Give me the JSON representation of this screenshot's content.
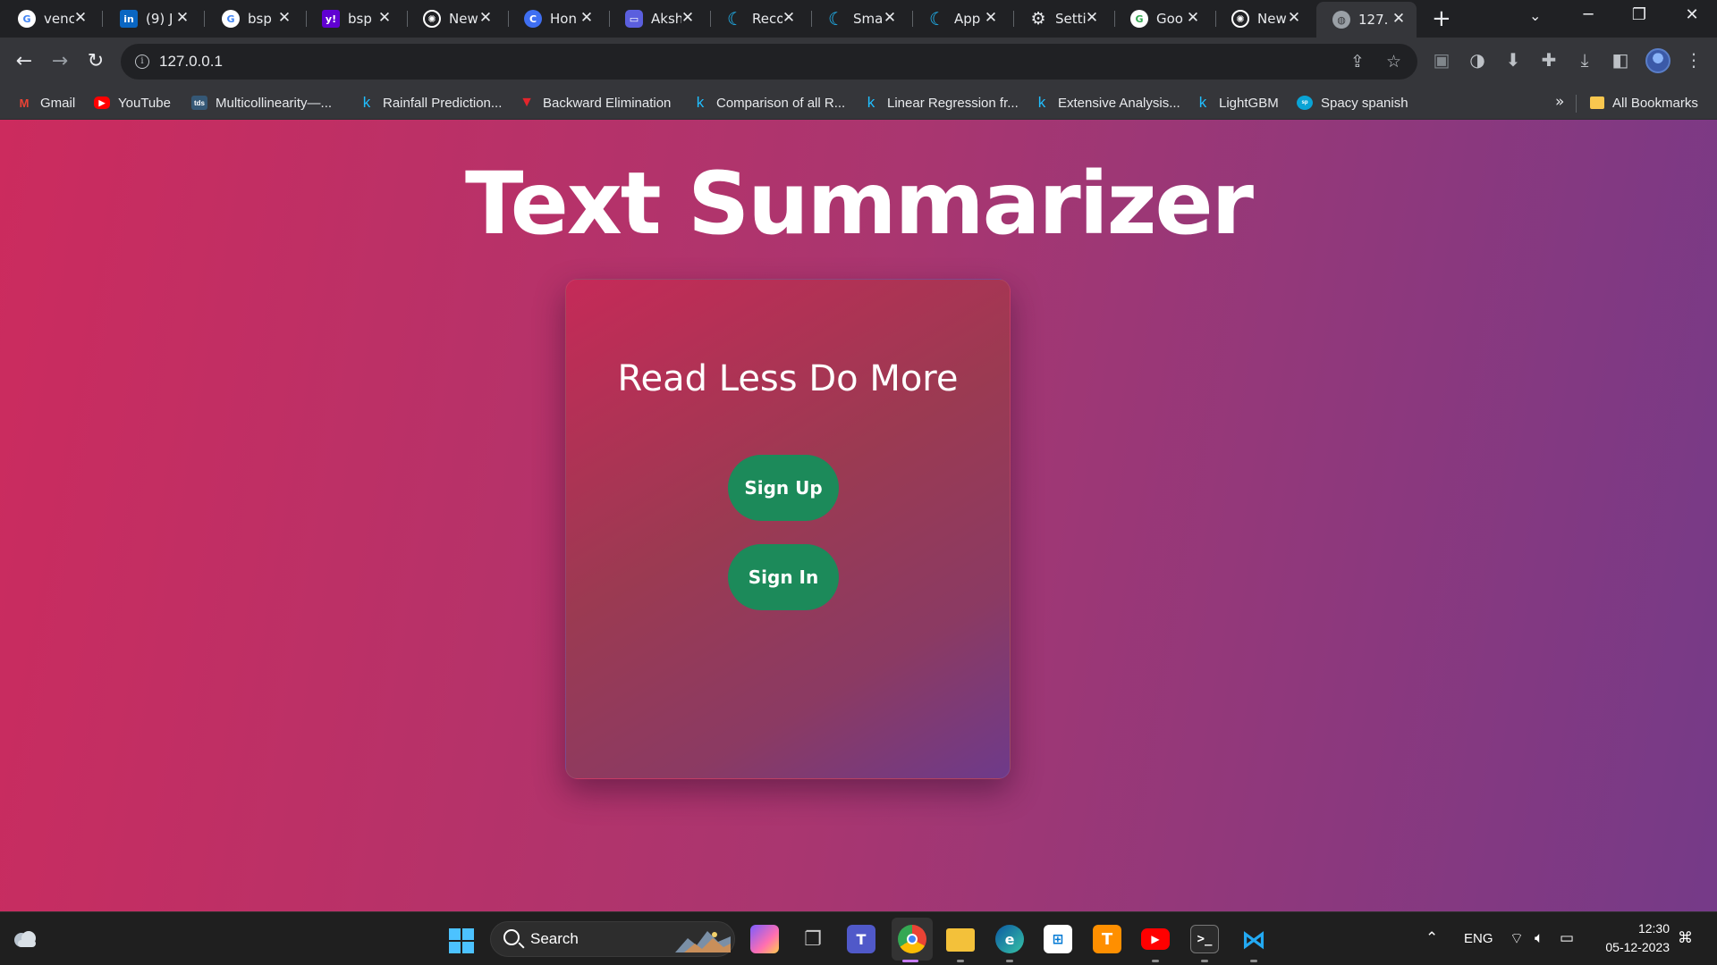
{
  "browser": {
    "tabs": [
      {
        "title": "venc",
        "icon": "google-icon",
        "color": "#ffffff"
      },
      {
        "title": "(9) J",
        "icon": "linkedin-icon",
        "color": "#0a66c2"
      },
      {
        "title": "bsp",
        "icon": "google-icon",
        "color": "#ffffff"
      },
      {
        "title": "bsp",
        "icon": "yahoo-icon",
        "color": "#6001d2"
      },
      {
        "title": "New",
        "icon": "chatgpt-icon",
        "color": "#ffffff"
      },
      {
        "title": "Hon",
        "icon": "copilot-icon",
        "color": "#3f6ff2"
      },
      {
        "title": "Aksh",
        "icon": "chat-app-icon",
        "color": "#5b5fde"
      },
      {
        "title": "Reco",
        "icon": "kaggle-k-icon",
        "color": "#20beff"
      },
      {
        "title": "Sma",
        "icon": "kaggle-k-icon",
        "color": "#20beff"
      },
      {
        "title": "App",
        "icon": "kaggle-k-icon",
        "color": "#20beff"
      },
      {
        "title": "Setti",
        "icon": "gear-icon",
        "color": "#e8eaed"
      },
      {
        "title": "Goo",
        "icon": "google-lens-icon",
        "color": "#ffffff"
      },
      {
        "title": "New",
        "icon": "chatgpt-icon",
        "color": "#ffffff"
      },
      {
        "title": "127.",
        "icon": "globe-icon",
        "color": "#9aa0a6"
      }
    ],
    "new_tab_label": "+",
    "url": "127.0.0.1",
    "bookmarks": [
      {
        "label": "Gmail",
        "icon": "gmail-icon",
        "color": "#ea4335"
      },
      {
        "label": "YouTube",
        "icon": "youtube-icon",
        "color": "#ff0000"
      },
      {
        "label": "Multicollinearity—...",
        "icon": "tds-icon",
        "color": "#355876"
      },
      {
        "label": "Rainfall Prediction...",
        "icon": "kaggle-k-icon",
        "color": "#20beff"
      },
      {
        "label": "Backward Elimination",
        "icon": "triangle-logo-icon",
        "color": "#e4252c"
      },
      {
        "label": "Comparison of all R...",
        "icon": "kaggle-k-icon",
        "color": "#20beff"
      },
      {
        "label": "Linear Regression fr...",
        "icon": "kaggle-k-icon",
        "color": "#20beff"
      },
      {
        "label": "Extensive Analysis...",
        "icon": "kaggle-k-icon",
        "color": "#20beff"
      },
      {
        "label": "LightGBM",
        "icon": "kaggle-k-icon",
        "color": "#20beff"
      },
      {
        "label": "Spacy spanish",
        "icon": "spacy-icon",
        "color": "#09a3d5"
      }
    ],
    "more_bookmarks_label": "»",
    "all_bookmarks_label": "All Bookmarks"
  },
  "page": {
    "title": "Text Summarizer",
    "card_heading": "Read Less Do More",
    "signup_label": "Sign Up",
    "signin_label": "Sign In",
    "colors": {
      "gradient_start": "#cc2b5e",
      "gradient_end": "#753a88",
      "button": "#1c8a5a"
    }
  },
  "taskbar": {
    "search_label": "Search",
    "language": "ENG",
    "time": "12:30",
    "date": "05-12-2023"
  }
}
